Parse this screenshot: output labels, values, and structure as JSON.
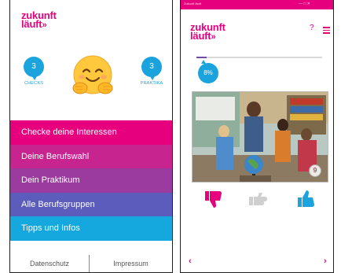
{
  "brand": {
    "line1": "zukunft",
    "line2": "läuft",
    "arrow": "»",
    "color": "#e6007e"
  },
  "home": {
    "stats": [
      {
        "value": "3",
        "label": "CHECKS"
      },
      {
        "value": "3",
        "label": "PRAKTIKA"
      }
    ],
    "emoji": "hugging-face-icon",
    "menu": [
      {
        "label": "Checke deine Interessen",
        "color": "#e6007e"
      },
      {
        "label": "Deine Berufswahl",
        "color": "#c8248f"
      },
      {
        "label": "Dein Praktikum",
        "color": "#9b3b9f"
      },
      {
        "label": "Alle Berufsgruppen",
        "color": "#5c5cbd"
      },
      {
        "label": "Tipps und Infos",
        "color": "#14a8de"
      }
    ],
    "footer": {
      "privacy": "Datenschutz",
      "imprint": "Impressum"
    }
  },
  "check": {
    "titlebar": {
      "title": "Zukunft läuft",
      "controls": "—   □   ✕"
    },
    "help": "?",
    "progress": {
      "percent_label": "8%",
      "fraction": 0.08
    },
    "card_count": "9",
    "ratings": [
      "thumb-down-icon",
      "thumb-neutral-icon",
      "thumb-up-icon"
    ],
    "nav": {
      "prev": "‹",
      "next": "›"
    },
    "accent_blue": "#1aa3dc"
  }
}
